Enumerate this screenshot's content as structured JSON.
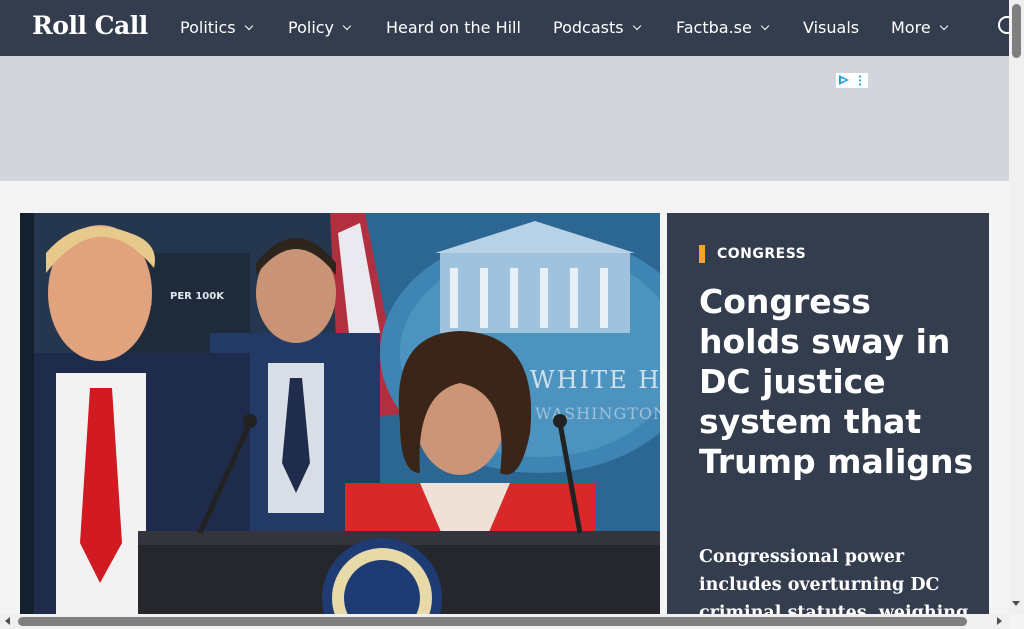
{
  "site": {
    "logo_text": "Roll Call"
  },
  "nav": {
    "items": [
      {
        "label": "Politics",
        "has_dropdown": true
      },
      {
        "label": "Policy",
        "has_dropdown": true
      },
      {
        "label": "Heard on the Hill",
        "has_dropdown": false
      },
      {
        "label": "Podcasts",
        "has_dropdown": true
      },
      {
        "label": "Factba.se",
        "has_dropdown": true
      },
      {
        "label": "Visuals",
        "has_dropdown": false
      },
      {
        "label": "More",
        "has_dropdown": true
      }
    ],
    "search_icon": "search-icon"
  },
  "ad": {
    "choices_icon": "adchoices-icon"
  },
  "hero": {
    "photo": "press-briefing-photo",
    "category": "CONGRESS",
    "headline": "Congress holds sway in DC justice system that Trump maligns",
    "dek": "Congressional power includes overturning DC criminal statutes, weighing"
  },
  "colors": {
    "nav_bg": "#333d4e",
    "panel_bg": "#333d4e",
    "accent": "#f5a623",
    "ad_band": "#d2d5dc",
    "page_bg": "#f4f4f4"
  }
}
